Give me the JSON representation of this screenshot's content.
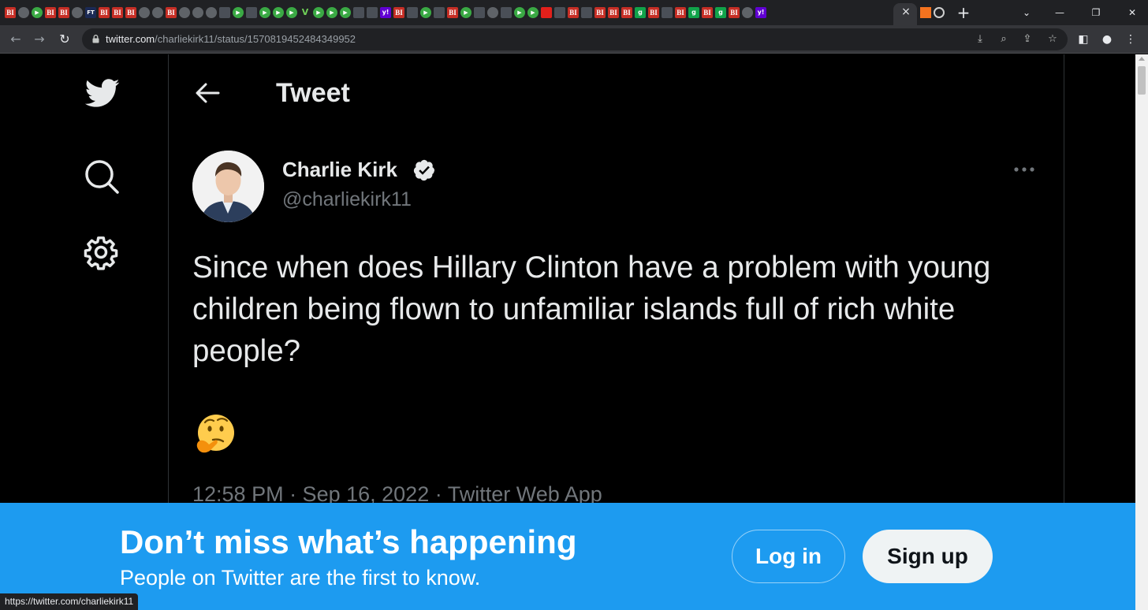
{
  "browser": {
    "tab_favicons": [
      "bi",
      "globe",
      "play",
      "bi",
      "bi",
      "globe",
      "ft",
      "bi",
      "bi",
      "bi",
      "globe",
      "globe",
      "bi",
      "globe",
      "globe",
      "globe",
      "dark",
      "play",
      "dark",
      "play",
      "play",
      "play",
      "vee",
      "play",
      "play",
      "play",
      "dark",
      "dark",
      "yahoo",
      "bi",
      "dark",
      "play",
      "dark",
      "bi",
      "play",
      "dark",
      "globe",
      "dark",
      "play",
      "play",
      "red",
      "dark",
      "bi",
      "dark",
      "bi",
      "bi",
      "bi",
      "green",
      "bi",
      "dark",
      "bi",
      "green",
      "bi",
      "green",
      "bi",
      "globe",
      "yahoo"
    ],
    "tab_favicon_labels": {
      "bi": "BI",
      "ft": "FT",
      "vee": "V",
      "yahoo": "y!",
      "green": "g",
      "red": "",
      "dark": "",
      "globe": "",
      "play": ""
    },
    "tab_close": "×",
    "new_tab": "+",
    "url_host": "twitter.com",
    "url_path": "/charliekirk11/status/1570819452484349952",
    "status_url": "https://twitter.com/charliekirk11"
  },
  "sidebar": {
    "logo_icon": "twitter-bird-icon",
    "search_icon": "search-icon",
    "settings_icon": "gear-icon"
  },
  "header": {
    "title": "Tweet"
  },
  "tweet": {
    "author_name": "Charlie Kirk",
    "author_handle": "@charliekirk11",
    "text": "Since when does Hillary Clinton have a problem with young children being flown to unfamiliar islands full of rich white people?",
    "emoji": "🤔",
    "meta": "12:58 PM · Sep 16, 2022 · Twitter Web App"
  },
  "banner": {
    "title": "Don’t miss what’s happening",
    "subtitle": "People on Twitter are the first to know.",
    "login_label": "Log in",
    "signup_label": "Sign up"
  },
  "colors": {
    "accent": "#1d9bf0",
    "background": "#000000",
    "text_primary": "#e7e9ea",
    "text_secondary": "#71767b"
  }
}
